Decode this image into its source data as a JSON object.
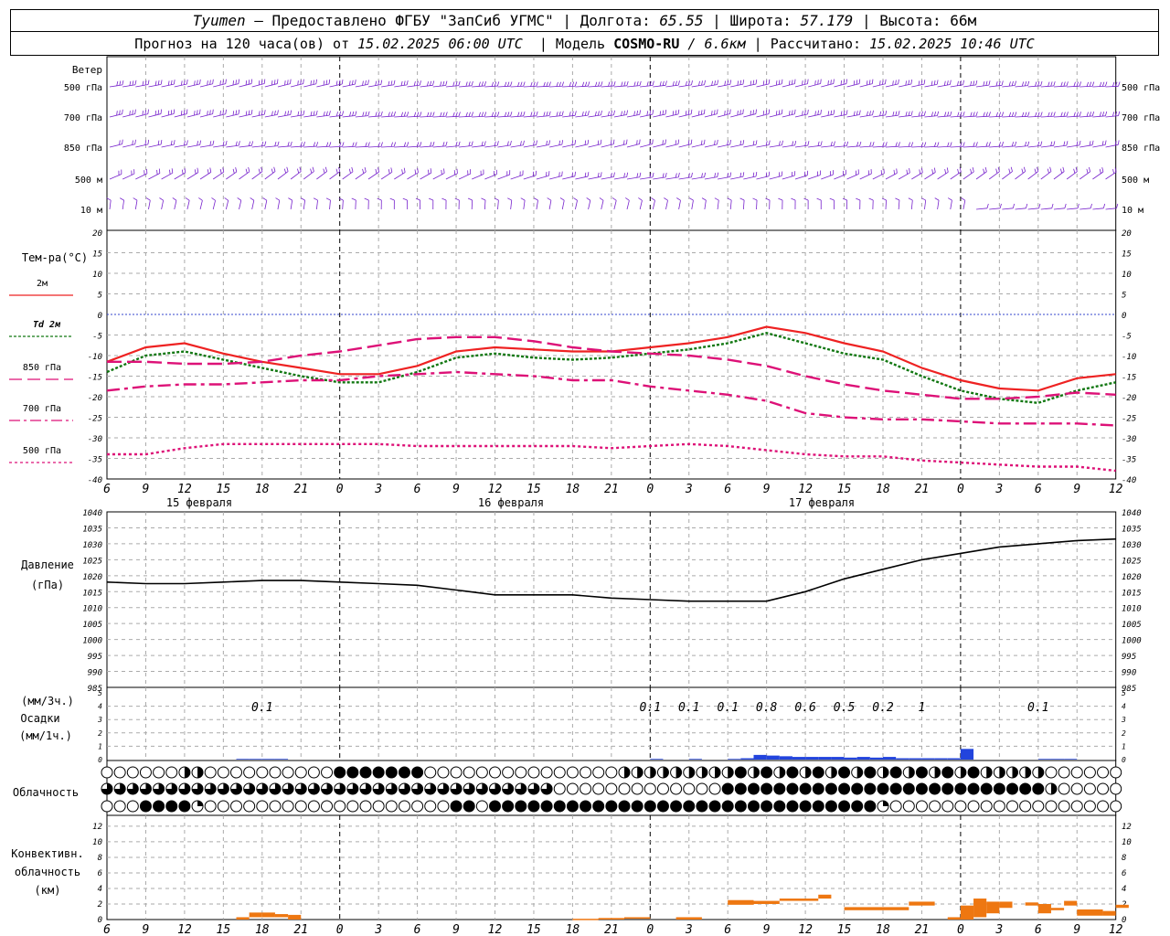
{
  "header": {
    "station": "Tyumen",
    "provider": "– Предоставлено ФГБУ \"ЗапСиб УГМС\"",
    "lon_label": "Долгота:",
    "lon_value": "65.55",
    "lat_label": "Широта:",
    "lat_value": "57.179",
    "alt_label": "Высота:",
    "alt_value": "66м",
    "forecast_label": "Прогноз на 120 часа(ов) от",
    "forecast_time": "15.02.2025 06:00 UTC",
    "model_label": "Модель",
    "model_name": "COSMO-RU",
    "model_res": "/ 6.6км",
    "calc_label": "Рассчитано:",
    "calc_time": "15.02.2025 10:46 UTC"
  },
  "x_ticks": [
    "6",
    "9",
    "12",
    "15",
    "18",
    "21",
    "0",
    "3",
    "6",
    "9",
    "12",
    "15",
    "18",
    "21",
    "0",
    "3",
    "6",
    "9",
    "12",
    "15",
    "18",
    "21",
    "0",
    "3",
    "6",
    "9",
    "12"
  ],
  "x_ticks_bottom": [
    "6",
    "9",
    "12",
    "15",
    "18",
    "21",
    "0",
    "3",
    "6",
    "9",
    "12",
    "15",
    "18",
    "21",
    "0",
    "3",
    "6",
    "9",
    "12",
    "15",
    "18",
    "21",
    "0",
    "3",
    "6",
    "9",
    "12"
  ],
  "dates": [
    "15 февраля",
    "16 февраля",
    "17 февраля"
  ],
  "wind": {
    "title": "Ветер",
    "levels": [
      "500 гПа",
      "700 гПа",
      "850 гПа",
      "500 м",
      "10  м"
    ]
  },
  "temperature": {
    "title": "Тем-ра(°C)",
    "y_ticks": [
      "20",
      "15",
      "10",
      "5",
      "0",
      "-5",
      "-10",
      "-15",
      "-20",
      "-25",
      "-30",
      "-35",
      "-40"
    ],
    "legend": [
      {
        "label": "2м",
        "color": "#ee2222"
      },
      {
        "label": "Td  2м",
        "color": "#117711"
      },
      {
        "label": "850 гПа",
        "color": "#dd1177"
      },
      {
        "label": "700 гПа",
        "color": "#dd1177"
      },
      {
        "label": "500 гПа",
        "color": "#dd1177"
      }
    ]
  },
  "pressure": {
    "title": "Давление",
    "unit": "(гПа)",
    "y_ticks": [
      "1040",
      "1035",
      "1030",
      "1025",
      "1020",
      "1015",
      "1010",
      "1005",
      "1000",
      "995",
      "990",
      "985"
    ]
  },
  "precip": {
    "unit_3h": "(мм/3ч.)",
    "title": "Осадки",
    "unit_1h": "(мм/1ч.)",
    "y_ticks": [
      "5",
      "4",
      "3",
      "2",
      "1",
      "0"
    ],
    "labels": [
      {
        "text": "0.1",
        "h": 12
      },
      {
        "text": "0.1",
        "h": 42
      },
      {
        "text": "0.1",
        "h": 45
      },
      {
        "text": "0.1",
        "h": 48
      },
      {
        "text": "0.8",
        "h": 51
      },
      {
        "text": "0.6",
        "h": 54
      },
      {
        "text": "0.5",
        "h": 57
      },
      {
        "text": "0.2",
        "h": 60
      },
      {
        "text": "1",
        "h": 63
      },
      {
        "text": "0.1",
        "h": 72
      }
    ]
  },
  "clouds": {
    "title": "Облачность"
  },
  "convective": {
    "title1": "Конвективн.",
    "title2": "облачность",
    "unit": "(км)",
    "y_ticks": [
      "12",
      "10",
      "8",
      "6",
      "4",
      "2",
      "0"
    ]
  },
  "colors": {
    "wind": "#7722cc",
    "t2m": "#ee2222",
    "td2m": "#117711",
    "upper": "#dd1177",
    "zero_line": "#3344cc",
    "pressure": "#000000",
    "precip": "#2244dd",
    "conv": "#ee7711",
    "grid": "#aaaaaa"
  },
  "chart_data": [
    {
      "type": "line",
      "title": "Тем-ра(°C)",
      "x": [
        "15.02 06",
        "15.02 09",
        "15.02 12",
        "15.02 15",
        "15.02 18",
        "15.02 21",
        "16.02 00",
        "16.02 03",
        "16.02 06",
        "16.02 09",
        "16.02 12",
        "16.02 15",
        "16.02 18",
        "16.02 21",
        "17.02 00",
        "17.02 03",
        "17.02 06",
        "17.02 09",
        "17.02 12",
        "17.02 15",
        "17.02 18",
        "17.02 21",
        "18.02 00",
        "18.02 03",
        "18.02 06",
        "18.02 09",
        "18.02 12"
      ],
      "ylim": [
        -40,
        20
      ],
      "series": [
        {
          "name": "2м",
          "values": [
            -11.5,
            -8,
            -7,
            -9.5,
            -11.5,
            -13,
            -14.5,
            -14.5,
            -12.5,
            -9,
            -8,
            -8.5,
            -9,
            -9,
            -8,
            -7,
            -5.5,
            -3,
            -4.5,
            -7,
            -9,
            -13,
            -16,
            -18,
            -18.5,
            -15.5,
            -14.5
          ]
        },
        {
          "name": "Td  2м",
          "values": [
            -14,
            -10,
            -9,
            -11,
            -13,
            -15,
            -16.5,
            -16.5,
            -14,
            -10.5,
            -9.5,
            -10.5,
            -11,
            -10.5,
            -9.5,
            -8.5,
            -7,
            -4.5,
            -7,
            -9.5,
            -11,
            -15,
            -18.5,
            -20.5,
            -21.5,
            -18.5,
            -16.5
          ]
        },
        {
          "name": "850 гПа",
          "values": [
            -11.5,
            -11.5,
            -12,
            -12,
            -11.5,
            -10,
            -9,
            -7.5,
            -6,
            -5.5,
            -5.5,
            -6.5,
            -8,
            -9,
            -9.5,
            -10,
            -11,
            -12.5,
            -15,
            -17,
            -18.5,
            -19.5,
            -20.5,
            -20.5,
            -20,
            -19,
            -19.5
          ]
        },
        {
          "name": "700 гПа",
          "values": [
            -18.5,
            -17.5,
            -17,
            -17,
            -16.5,
            -16,
            -16,
            -15,
            -14.5,
            -14,
            -14.5,
            -15,
            -16,
            -16,
            -17.5,
            -18.5,
            -19.5,
            -21,
            -24,
            -25,
            -25.5,
            -25.5,
            -26,
            -26.5,
            -26.5,
            -26.5,
            -27
          ]
        },
        {
          "name": "500 гПа",
          "values": [
            -34,
            -34,
            -32.5,
            -31.5,
            -31.5,
            -31.5,
            -31.5,
            -31.5,
            -32,
            -32,
            -32,
            -32,
            -32,
            -32.5,
            -32,
            -31.5,
            -32,
            -33,
            -34,
            -34.5,
            -34.5,
            -35.5,
            -36,
            -36.5,
            -37,
            -37,
            -38
          ]
        }
      ]
    },
    {
      "type": "line",
      "title": "Давление",
      "x": [
        "15.02 06",
        "15.02 09",
        "15.02 12",
        "15.02 15",
        "15.02 18",
        "15.02 21",
        "16.02 00",
        "16.02 03",
        "16.02 06",
        "16.02 09",
        "16.02 12",
        "16.02 15",
        "16.02 18",
        "16.02 21",
        "17.02 00",
        "17.02 03",
        "17.02 06",
        "17.02 09",
        "17.02 12",
        "17.02 15",
        "17.02 18",
        "17.02 21",
        "18.02 00",
        "18.02 03",
        "18.02 06",
        "18.02 09",
        "18.02 12"
      ],
      "ylim": [
        985,
        1040
      ],
      "series": [
        {
          "name": "Давление",
          "values": [
            1018,
            1017.5,
            1017.5,
            1018,
            1018.5,
            1018.5,
            1018,
            1017.5,
            1017,
            1015.5,
            1014,
            1014,
            1014,
            1013,
            1012.5,
            1012,
            1012,
            1012,
            1015,
            1019,
            1022,
            1025,
            1027,
            1029,
            1030,
            1031,
            1031.5
          ]
        }
      ]
    },
    {
      "type": "bar",
      "title": "Осадки",
      "ylim": [
        0,
        5
      ],
      "bars": [
        {
          "h": 10,
          "v": 0.05
        },
        {
          "h": 11,
          "v": 0.05
        },
        {
          "h": 12,
          "v": 0.05
        },
        {
          "h": 13,
          "v": 0.05
        },
        {
          "h": 42,
          "v": 0.05
        },
        {
          "h": 45,
          "v": 0.05
        },
        {
          "h": 48,
          "v": 0.05
        },
        {
          "h": 49,
          "v": 0.1
        },
        {
          "h": 50,
          "v": 0.35
        },
        {
          "h": 51,
          "v": 0.3
        },
        {
          "h": 52,
          "v": 0.25
        },
        {
          "h": 53,
          "v": 0.2
        },
        {
          "h": 54,
          "v": 0.2
        },
        {
          "h": 55,
          "v": 0.2
        },
        {
          "h": 56,
          "v": 0.2
        },
        {
          "h": 57,
          "v": 0.15
        },
        {
          "h": 58,
          "v": 0.2
        },
        {
          "h": 59,
          "v": 0.15
        },
        {
          "h": 60,
          "v": 0.2
        },
        {
          "h": 61,
          "v": 0.1
        },
        {
          "h": 62,
          "v": 0.1
        },
        {
          "h": 63,
          "v": 0.1
        },
        {
          "h": 64,
          "v": 0.1
        },
        {
          "h": 65,
          "v": 0.1
        },
        {
          "h": 66,
          "v": 0.8
        },
        {
          "h": 72,
          "v": 0.05
        },
        {
          "h": 73,
          "v": 0.05
        },
        {
          "h": 74,
          "v": 0.05
        }
      ]
    },
    {
      "type": "bar",
      "title": "Конвективн. облачность",
      "ylim": [
        0,
        13
      ],
      "bars": [
        {
          "h0": 10,
          "h1": 11,
          "bot": 0,
          "top": 0.3
        },
        {
          "h0": 11,
          "h1": 12,
          "bot": 0.3,
          "top": 0.9
        },
        {
          "h0": 12,
          "h1": 13,
          "bot": 0.3,
          "top": 0.9
        },
        {
          "h0": 13,
          "h1": 14,
          "bot": 0.3,
          "top": 0.7
        },
        {
          "h0": 14,
          "h1": 15,
          "bot": 0,
          "top": 0.6
        },
        {
          "h0": 36,
          "h1": 38,
          "bot": 0,
          "top": 0.1
        },
        {
          "h0": 38,
          "h1": 40,
          "bot": 0,
          "top": 0.2
        },
        {
          "h0": 40,
          "h1": 42,
          "bot": 0.1,
          "top": 0.3
        },
        {
          "h0": 44,
          "h1": 46,
          "bot": 0,
          "top": 0.3
        },
        {
          "h0": 48,
          "h1": 50,
          "bot": 1.9,
          "top": 2.5
        },
        {
          "h0": 50,
          "h1": 52,
          "bot": 2.0,
          "top": 2.4
        },
        {
          "h0": 52,
          "h1": 55,
          "bot": 2.4,
          "top": 2.7
        },
        {
          "h0": 55,
          "h1": 56,
          "bot": 2.7,
          "top": 3.2
        },
        {
          "h0": 57,
          "h1": 62,
          "bot": 1.2,
          "top": 1.6
        },
        {
          "h0": 62,
          "h1": 64,
          "bot": 1.8,
          "top": 2.3
        },
        {
          "h0": 65,
          "h1": 66,
          "bot": 0,
          "top": 0.3
        },
        {
          "h0": 66,
          "h1": 67,
          "bot": 0,
          "top": 1.8
        },
        {
          "h0": 67,
          "h1": 68,
          "bot": 0.3,
          "top": 2.7
        },
        {
          "h0": 68,
          "h1": 69,
          "bot": 0.8,
          "top": 2.3
        },
        {
          "h0": 69,
          "h1": 70,
          "bot": 1.5,
          "top": 2.3
        },
        {
          "h0": 71,
          "h1": 72,
          "bot": 1.8,
          "top": 2.2
        },
        {
          "h0": 72,
          "h1": 73,
          "bot": 0.8,
          "top": 2.0
        },
        {
          "h0": 73,
          "h1": 74,
          "bot": 1.2,
          "top": 1.5
        },
        {
          "h0": 74,
          "h1": 75,
          "bot": 1.8,
          "top": 2.4
        },
        {
          "h0": 75,
          "h1": 77,
          "bot": 0.5,
          "top": 1.3
        },
        {
          "h0": 77,
          "h1": 78,
          "bot": 0.5,
          "top": 1.1
        },
        {
          "h0": 78,
          "h1": 79,
          "bot": 1.5,
          "top": 1.9
        }
      ]
    }
  ]
}
